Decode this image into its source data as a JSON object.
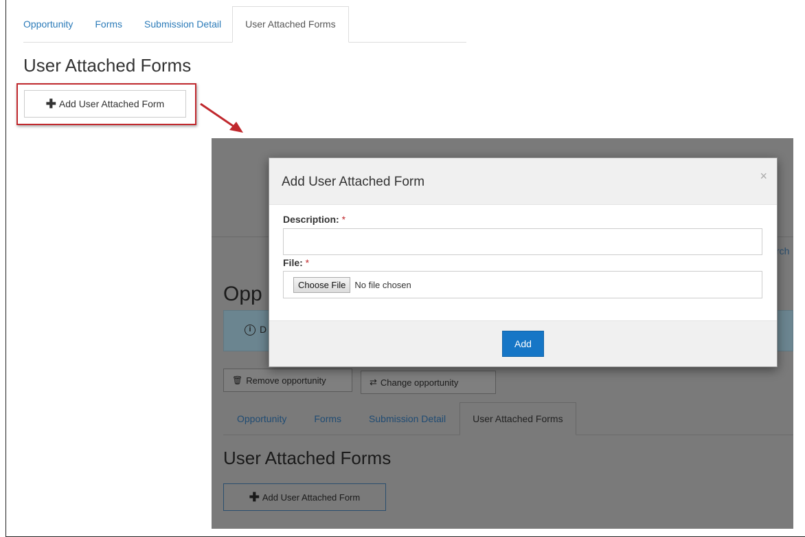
{
  "top": {
    "tabs": [
      {
        "label": "Opportunity"
      },
      {
        "label": "Forms"
      },
      {
        "label": "Submission Detail"
      },
      {
        "label": "User Attached Forms"
      }
    ],
    "title": "User Attached Forms",
    "add_button": "Add User Attached Form"
  },
  "background": {
    "search_fragment": "rch",
    "opportunity_heading": "Opp",
    "info_fragment": "D",
    "remove_button": "Remove opportunity",
    "change_button": "Change opportunity",
    "tabs": [
      {
        "label": "Opportunity"
      },
      {
        "label": "Forms"
      },
      {
        "label": "Submission Detail"
      },
      {
        "label": "User Attached Forms"
      }
    ],
    "title": "User Attached Forms",
    "add_button": "Add User Attached Form"
  },
  "modal": {
    "title": "Add User Attached Form",
    "close": "×",
    "description_label": "Description:",
    "required_mark": "*",
    "file_label": "File:",
    "choose_file": "Choose File",
    "no_file": "No file chosen",
    "submit": "Add"
  },
  "colors": {
    "link": "#2a7ab8",
    "highlight": "#c0282d",
    "primary": "#1676c6"
  }
}
